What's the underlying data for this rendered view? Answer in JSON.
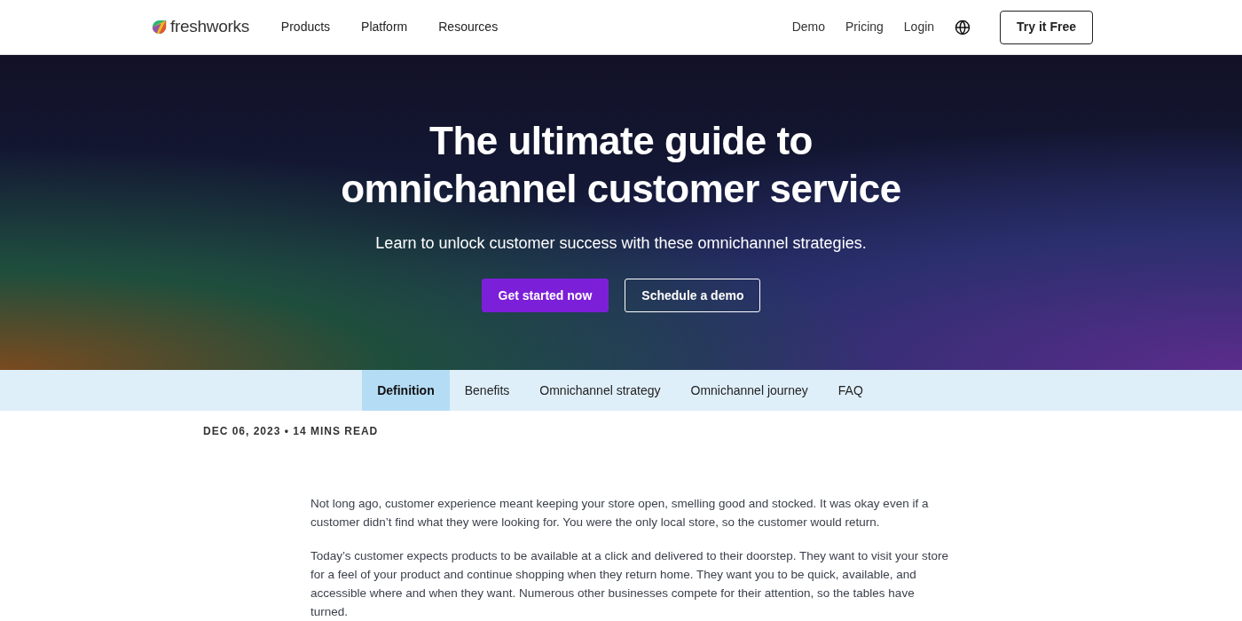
{
  "nav": {
    "logo": "freshworks",
    "menu": [
      "Products",
      "Platform",
      "Resources"
    ],
    "links": [
      "Demo",
      "Pricing",
      "Login"
    ],
    "cta": "Try it Free"
  },
  "hero": {
    "title": "The ultimate guide to omnichannel customer service",
    "subtitle": "Learn to unlock customer success with these omnichannel strategies.",
    "buttons": [
      {
        "label": "Get started now",
        "kind": "primary"
      },
      {
        "label": "Schedule a demo",
        "kind": "outline"
      }
    ]
  },
  "tabs": [
    {
      "label": "Definition",
      "selected": true
    },
    {
      "label": "Benefits",
      "selected": false
    },
    {
      "label": "Omnichannel strategy",
      "selected": false
    },
    {
      "label": "Omnichannel journey",
      "selected": false
    },
    {
      "label": "FAQ",
      "selected": false
    }
  ],
  "meta": "DEC 06, 2023 • 14 MINS READ",
  "paragraphs": [
    "Not long ago, customer experience meant keeping your store open, smelling good and stocked. It was okay even if a customer didn’t find what they were looking for. You were the only local store, so the customer would return.",
    "Today’s customer expects products to be available at a click and delivered to their doorstep. They want to visit your store for a feel of your product and continue shopping when they return home. They want you to be quick, available, and accessible where and when they want. Numerous other businesses compete for their attention, so the tables have turned."
  ]
}
